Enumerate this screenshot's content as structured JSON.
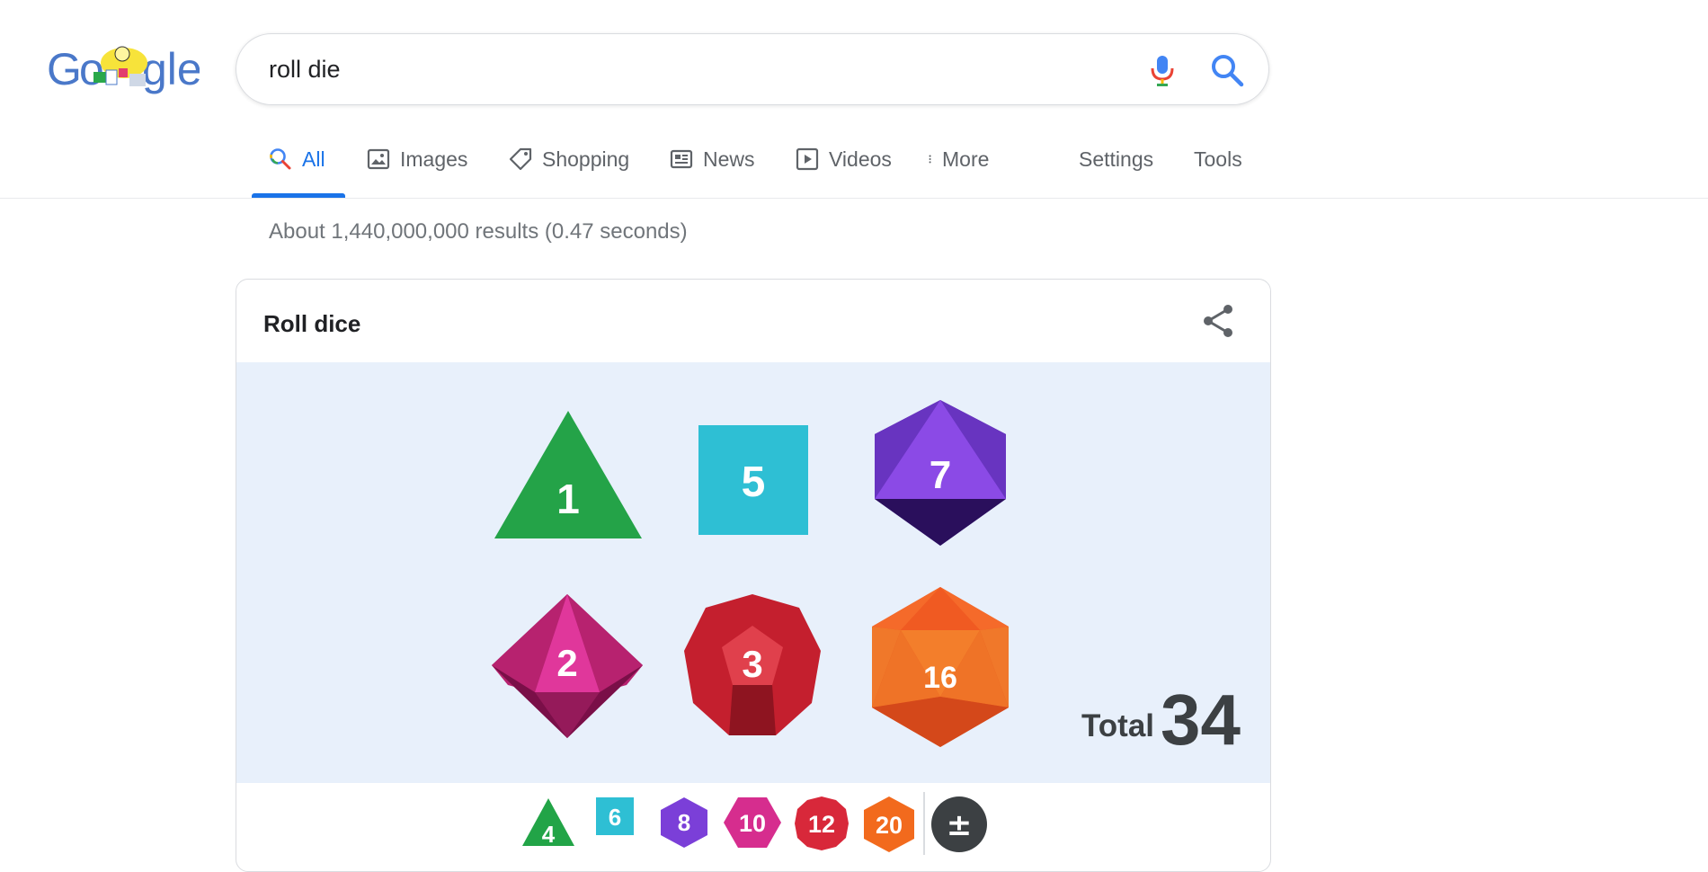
{
  "search": {
    "query": "roll die"
  },
  "tabs": [
    {
      "label": "All",
      "active": true
    },
    {
      "label": "Images"
    },
    {
      "label": "Shopping"
    },
    {
      "label": "News"
    },
    {
      "label": "Videos"
    },
    {
      "label": "More"
    },
    {
      "label": "Settings"
    },
    {
      "label": "Tools"
    }
  ],
  "result_stats": "About 1,440,000,000 results (0.47 seconds)",
  "card": {
    "title": "Roll dice",
    "dice": [
      {
        "type": "d4",
        "value": "1",
        "color": "#22a447"
      },
      {
        "type": "d6",
        "value": "5",
        "color": "#2ebfd4"
      },
      {
        "type": "d8",
        "value": "7",
        "color": "#7b3fd8"
      },
      {
        "type": "d10",
        "value": "2",
        "color": "#d62d8e"
      },
      {
        "type": "d12",
        "value": "3",
        "color": "#d8283a"
      },
      {
        "type": "d20",
        "value": "16",
        "color": "#f26a1d"
      }
    ],
    "total_label": "Total",
    "total_value": "34",
    "picker": [
      {
        "label": "4",
        "color": "#22a447"
      },
      {
        "label": "6",
        "color": "#2ebfd4"
      },
      {
        "label": "8",
        "color": "#7b3fd8"
      },
      {
        "label": "10",
        "color": "#d62d8e"
      },
      {
        "label": "12",
        "color": "#d8283a"
      },
      {
        "label": "20",
        "color": "#f26a1d"
      },
      {
        "label": "±",
        "color": "#3c4043"
      }
    ]
  },
  "colors": {
    "accent": "#1a73e8",
    "dice_bg": "#e8f0fb"
  }
}
